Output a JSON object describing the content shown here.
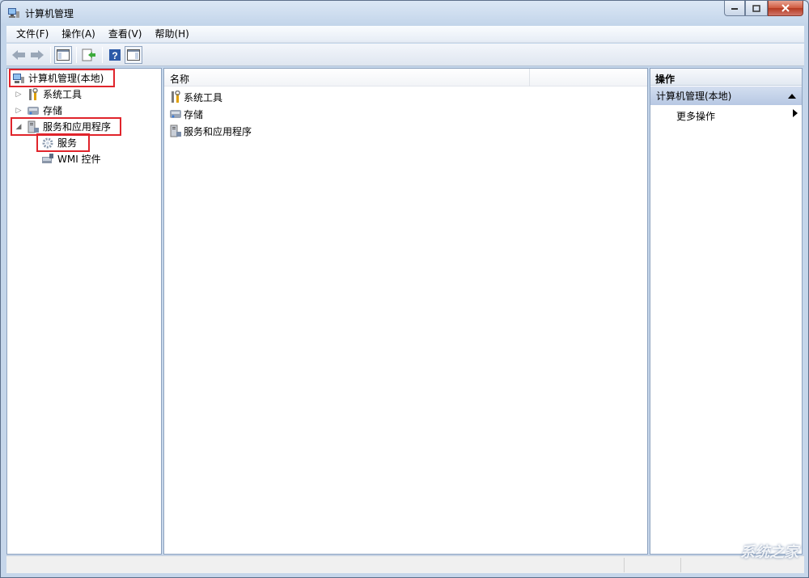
{
  "window": {
    "title": "计算机管理"
  },
  "menu": [
    "文件(F)",
    "操作(A)",
    "查看(V)",
    "帮助(H)"
  ],
  "tree": {
    "root": "计算机管理(本地)",
    "system_tools": "系统工具",
    "storage": "存储",
    "services_apps": "服务和应用程序",
    "services": "服务",
    "wmi": "WMI 控件"
  },
  "list": {
    "column_name": "名称",
    "items": [
      "系统工具",
      "存储",
      "服务和应用程序"
    ]
  },
  "actions": {
    "header": "操作",
    "section": "计算机管理(本地)",
    "more": "更多操作"
  },
  "watermark": "系统之家",
  "colors": {
    "highlight": "#e0242b",
    "accent": "#b7c8e3"
  }
}
